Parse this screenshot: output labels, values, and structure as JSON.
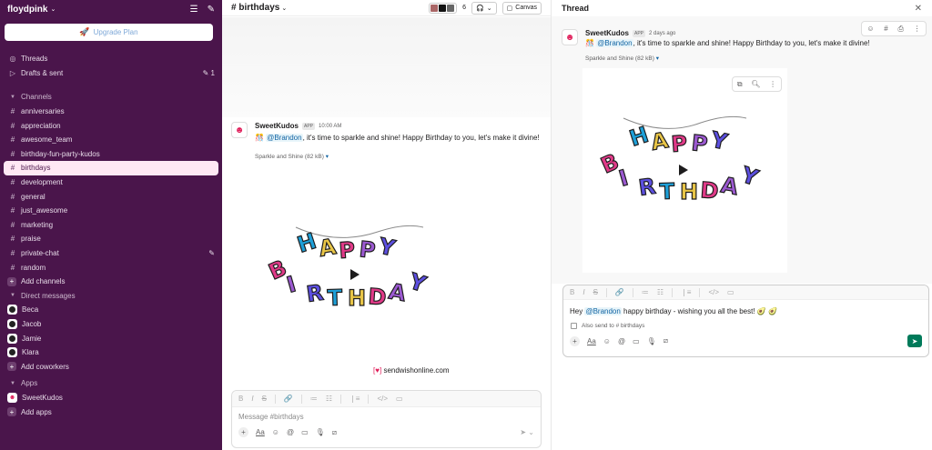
{
  "workspace": {
    "name": "floydpink"
  },
  "upgrade": {
    "label": "Upgrade Plan"
  },
  "nav": {
    "threads": "Threads",
    "drafts": "Drafts & sent",
    "drafts_count": "1",
    "channels_header": "Channels",
    "channels": [
      "anniversaries",
      "appreciation",
      "awesome_team",
      "birthday-fun-party-kudos",
      "birthdays",
      "development",
      "general",
      "just_awesome",
      "marketing",
      "praise",
      "private-chat",
      "random"
    ],
    "add_channels": "Add channels",
    "dm_header": "Direct messages",
    "dms": [
      "Beca",
      "Jacob",
      "Jamie",
      "Klara"
    ],
    "add_coworkers": "Add coworkers",
    "apps_header": "Apps",
    "apps": [
      "SweetKudos"
    ],
    "add_apps": "Add apps"
  },
  "channel": {
    "title": "# birthdays",
    "member_count": "6",
    "canvas_label": "Canvas",
    "message": {
      "author": "SweetKudos",
      "badge": "APP",
      "time": "10:00 AM",
      "emoji": "🎊",
      "mention": "@Brandon",
      "text": ", it's time to sparkle and shine! Happy Birthday to you, let's make it divine!",
      "attachment": "Sparkle and Shine (82 kB)"
    },
    "gif_credit": "sendwishonline.com",
    "composer_placeholder": "Message #birthdays"
  },
  "banner": {
    "line1": "HAPPY",
    "line2": "BIRTHDAY"
  },
  "thread": {
    "title": "Thread",
    "message": {
      "author": "SweetKudos",
      "badge": "APP",
      "time": "2 days ago",
      "emoji": "🎊",
      "mention": "@Brandon",
      "text": ", it's time to sparkle and shine! Happy Birthday to you, let's make it divine!",
      "attachment": "Sparkle and Shine (82 kB)"
    },
    "reply": {
      "prefix": "Hey ",
      "mention": "@Brandon",
      "text": " happy birthday - wishing you all the best! 🥑 🥑",
      "also_send": "Also send to # birthdays"
    }
  },
  "colors": {
    "sidebar_bg": "#4a154b",
    "selected_bg": "#ffe8f4",
    "mention": "#1264a3",
    "send_button": "#007a5a",
    "banner_letters": [
      "#1ea0d8",
      "#e8c547",
      "#e03a88",
      "#9b59d0",
      "#5c4fe0"
    ]
  }
}
